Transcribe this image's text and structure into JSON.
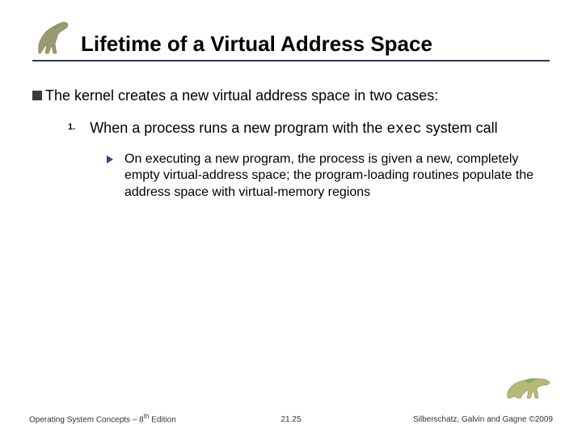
{
  "title": "Lifetime of a Virtual Address Space",
  "bullet_main": "The kernel creates a new virtual address space in two cases:",
  "item1": {
    "marker": "1.",
    "text_a": "When a process runs a new program with the ",
    "code": "exec",
    "text_b": " system call"
  },
  "sub1": "On executing a new program, the process is given a new, completely empty virtual-address space; the program-loading routines populate the address space with virtual-memory regions",
  "footer": {
    "left_a": "Operating System Concepts – 8",
    "left_sup": "th",
    "left_b": " Edition",
    "center": "21.25",
    "right": "Silberschatz, Galvin and Gagne ©2009"
  }
}
